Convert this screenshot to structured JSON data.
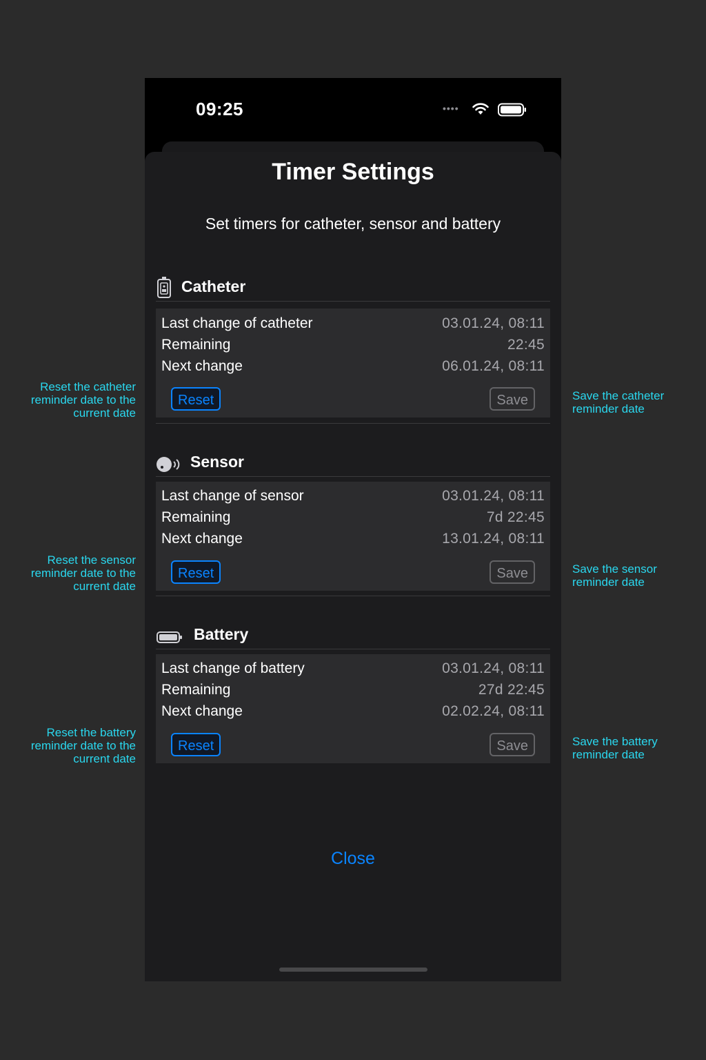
{
  "status_bar": {
    "time": "09:25",
    "signal_dots": "••••"
  },
  "sheet": {
    "title": "Timer Settings",
    "subtitle": "Set timers for catheter, sensor and battery",
    "close_label": "Close"
  },
  "sections": {
    "catheter": {
      "icon": "catheter-icon",
      "title": "Catheter",
      "rows": [
        {
          "label": "Last change of catheter",
          "value": "03.01.24, 08:11"
        },
        {
          "label": "Remaining",
          "value": "22:45"
        },
        {
          "label": "Next change",
          "value": "06.01.24, 08:11"
        }
      ],
      "reset_label": "Reset",
      "save_label": "Save"
    },
    "sensor": {
      "icon": "sensor-icon",
      "title": "Sensor",
      "rows": [
        {
          "label": "Last change of sensor",
          "value": "03.01.24, 08:11"
        },
        {
          "label": "Remaining",
          "value": "7d 22:45"
        },
        {
          "label": "Next change",
          "value": "13.01.24, 08:11"
        }
      ],
      "reset_label": "Reset",
      "save_label": "Save"
    },
    "battery": {
      "icon": "battery-icon",
      "title": "Battery",
      "rows": [
        {
          "label": "Last change of battery",
          "value": "03.01.24, 08:11"
        },
        {
          "label": "Remaining",
          "value": "27d 22:45"
        },
        {
          "label": "Next change",
          "value": "02.02.24, 08:11"
        }
      ],
      "reset_label": "Reset",
      "save_label": "Save"
    }
  },
  "annotations": {
    "catheter_reset": [
      "Reset the catheter",
      "reminder date to the",
      "current date"
    ],
    "catheter_save": [
      "Save the catheter",
      "reminder date"
    ],
    "sensor_reset": [
      "Reset the sensor",
      "reminder date to the",
      "current date"
    ],
    "sensor_save": [
      "Save the sensor",
      "reminder date"
    ],
    "battery_reset": [
      "Reset the battery",
      "reminder date to the",
      "current date"
    ],
    "battery_save": [
      "Save the battery",
      "reminder date"
    ]
  },
  "colors": {
    "accent": "#0a84ff",
    "annotation": "#2ad7ee",
    "sheet_bg": "#1c1c1e",
    "card_bg": "#2c2c2e"
  }
}
